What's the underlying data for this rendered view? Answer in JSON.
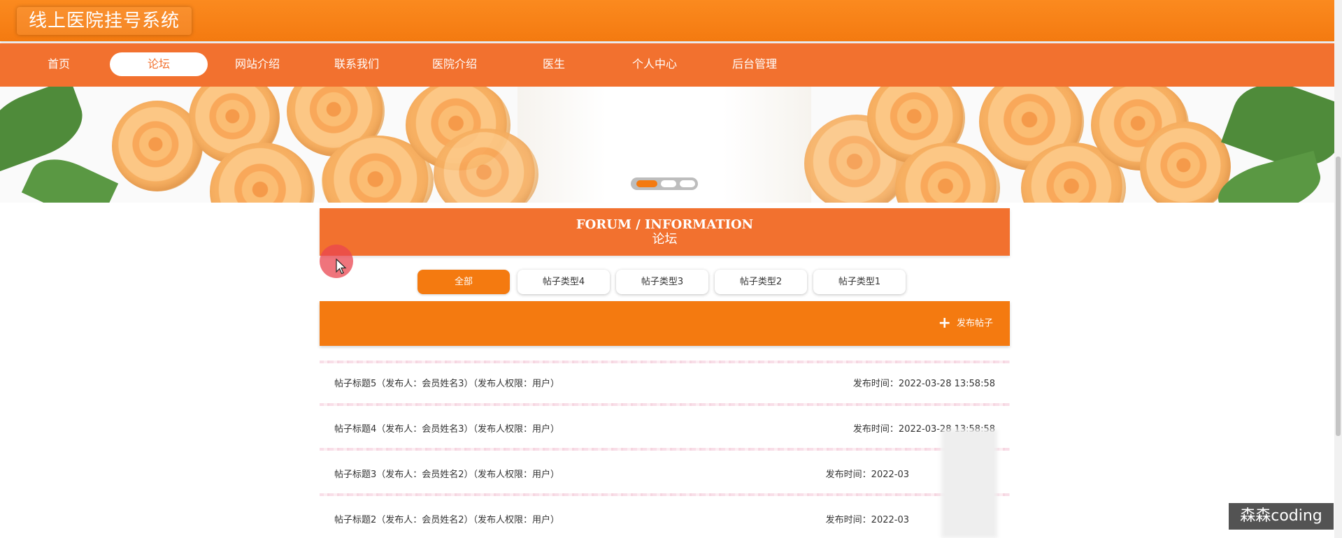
{
  "header": {
    "title": "线上医院挂号系统"
  },
  "nav": {
    "items": [
      {
        "label": "首页",
        "active": false
      },
      {
        "label": "论坛",
        "active": true
      },
      {
        "label": "网站介绍",
        "active": false
      },
      {
        "label": "联系我们",
        "active": false
      },
      {
        "label": "医院介绍",
        "active": false
      },
      {
        "label": "医生",
        "active": false
      },
      {
        "label": "个人中心",
        "active": false
      },
      {
        "label": "后台管理",
        "active": false
      }
    ]
  },
  "banner": {
    "slides": 3,
    "active_slide": 1
  },
  "forum": {
    "title_en": "FORUM / INFORMATION",
    "title_cn": "论坛"
  },
  "categories": [
    {
      "label": "全部",
      "active": true
    },
    {
      "label": "帖子类型4",
      "active": false
    },
    {
      "label": "帖子类型3",
      "active": false
    },
    {
      "label": "帖子类型2",
      "active": false
    },
    {
      "label": "帖子类型1",
      "active": false
    }
  ],
  "publish": {
    "label": "发布帖子",
    "icon": "plus-icon"
  },
  "posts": [
    {
      "title": "帖子标题5（发布人：会员姓名3）（发布人权限：用户）",
      "time": "发布时间：2022-03-28 13:58:58"
    },
    {
      "title": "帖子标题4（发布人：会员姓名3）（发布人权限：用户）",
      "time": "发布时间：2022-03-28 13:58:58"
    },
    {
      "title": "帖子标题3（发布人：会员姓名2）（发布人权限：用户）",
      "time": "发布时间：2022-03"
    },
    {
      "title": "帖子标题2（发布人：会员姓名2）（发布人权限：用户）",
      "time": "发布时间：2022-03"
    }
  ],
  "watermark": "森森coding",
  "colors": {
    "primary": "#f47a10",
    "nav": "#f2712f",
    "forum_head": "#f2712f"
  }
}
